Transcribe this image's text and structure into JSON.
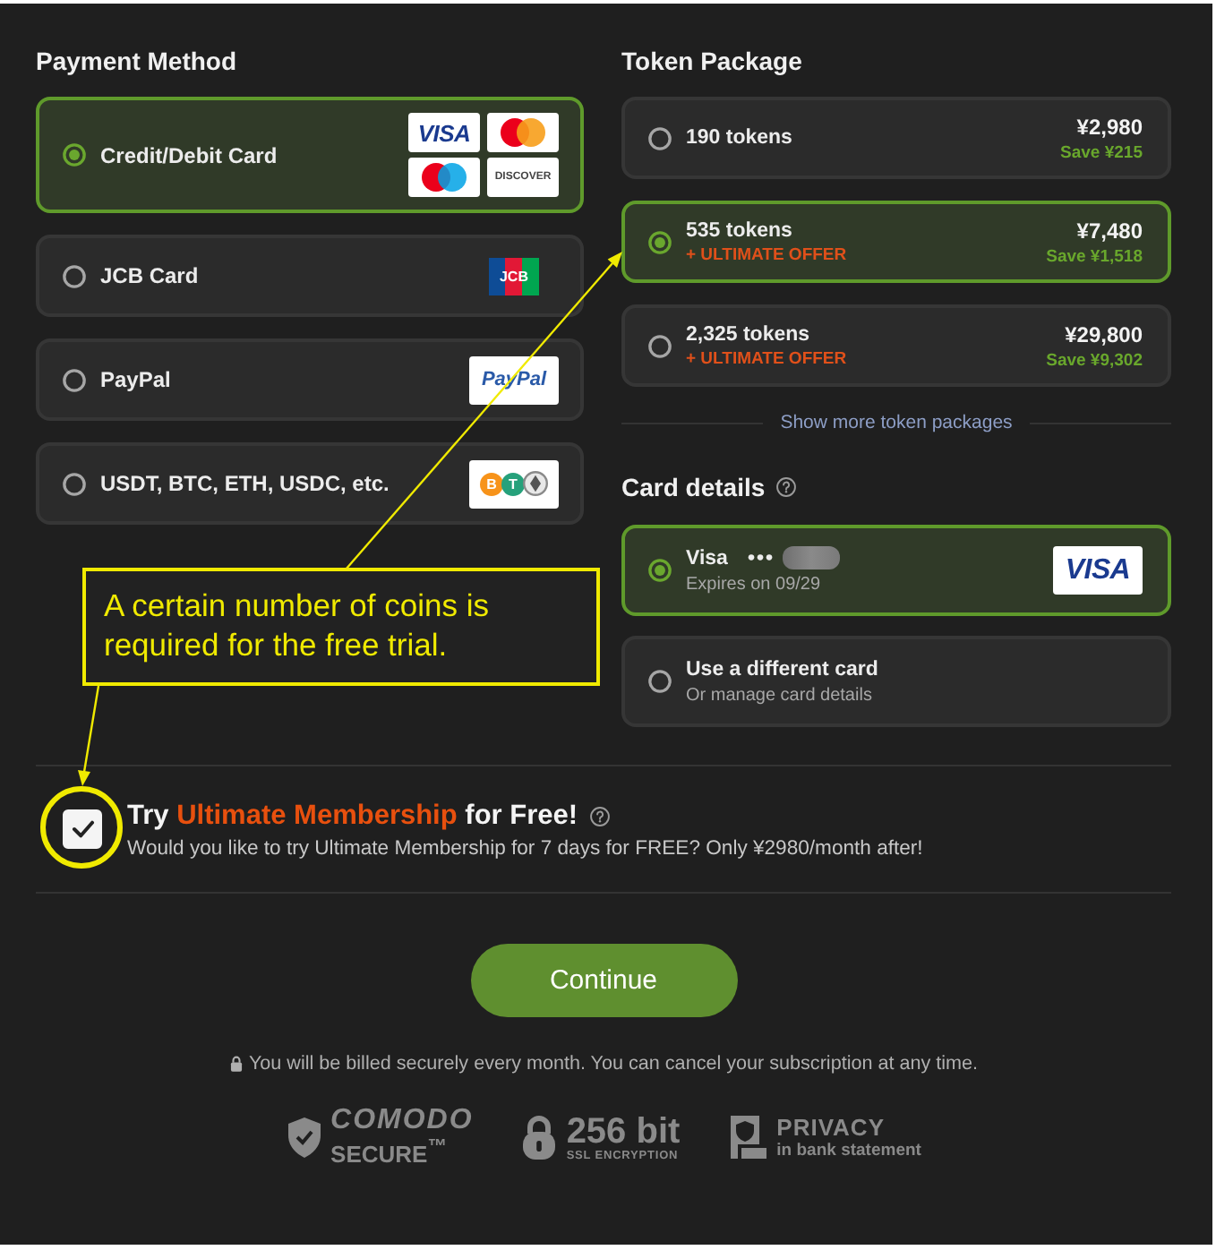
{
  "payment": {
    "heading": "Payment Method",
    "methods": [
      {
        "label": "Credit/Debit Card",
        "selected": true,
        "logos": [
          {
            "kind": "visa",
            "text": "VISA"
          },
          {
            "kind": "mastercard"
          },
          {
            "kind": "maestro"
          },
          {
            "kind": "discover",
            "text": "DISCOVER"
          }
        ]
      },
      {
        "label": "JCB Card",
        "selected": false,
        "logos": [
          {
            "kind": "jcb",
            "text": "JCB"
          }
        ]
      },
      {
        "label": "PayPal",
        "selected": false,
        "logos": [
          {
            "kind": "paypal",
            "text": "PayPal"
          }
        ]
      },
      {
        "label": "USDT, BTC, ETH, USDC, etc.",
        "selected": false,
        "logos": [
          {
            "kind": "crypto",
            "coins": [
              {
                "symbol": "B",
                "color": "#f7931a"
              },
              {
                "symbol": "T",
                "color": "#26a17b"
              }
            ]
          }
        ]
      }
    ]
  },
  "tokens": {
    "heading": "Token Package",
    "packages": [
      {
        "name": "190 tokens",
        "price": "¥2,980",
        "save": "Save ¥215",
        "selected": false
      },
      {
        "name": "535 tokens",
        "offer": "+ ULTIMATE OFFER",
        "price": "¥7,480",
        "save": "Save ¥1,518",
        "selected": true
      },
      {
        "name": "2,325 tokens",
        "offer": "+ ULTIMATE OFFER",
        "price": "¥29,800",
        "save": "Save ¥9,302",
        "selected": false
      }
    ],
    "more_link": "Show more token packages"
  },
  "card_details": {
    "heading": "Card details",
    "cards": [
      {
        "kind": "saved",
        "title": "Visa",
        "masked": "•••",
        "subtitle": "Expires on 09/29",
        "logo": "VISA",
        "selected": true
      },
      {
        "kind": "new",
        "title": "Use a different card",
        "subtitle": "Or manage card details",
        "selected": false
      }
    ]
  },
  "annotation": {
    "text": "A certain number of coins is required for the free trial."
  },
  "trial": {
    "checked": true,
    "title": [
      {
        "text": "Try",
        "highlight": false
      },
      {
        "text": "Ultimate Membership",
        "highlight": true
      },
      {
        "text": "for Free!",
        "highlight": false
      }
    ],
    "description": "Would you like to try Ultimate Membership for 7 days for FREE? Only ¥2980/month after!"
  },
  "continue_button": "Continue",
  "billing_note": "You will be billed securely every month. You can cancel your subscription at any time.",
  "badges": [
    {
      "kind": "comodo",
      "title": "COMODO",
      "subtitle": "SECURE$^{™}$"
    },
    {
      "kind": "ssl",
      "title": "256 bit",
      "subtitle": "SSL ENCRYPTION"
    },
    {
      "kind": "privacy",
      "title": "PRIVACY",
      "subtitle": "in bank statement"
    }
  ]
}
